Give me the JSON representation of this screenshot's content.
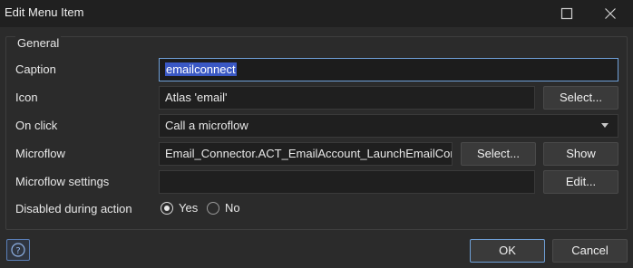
{
  "window": {
    "title": "Edit Menu Item"
  },
  "group": {
    "legend": "General"
  },
  "caption": {
    "label": "Caption",
    "value": "emailconnect"
  },
  "icon": {
    "label": "Icon",
    "value": "Atlas 'email'",
    "select_label": "Select..."
  },
  "on_click": {
    "label": "On click",
    "value": "Call a microflow"
  },
  "microflow": {
    "label": "Microflow",
    "value": "Email_Connector.ACT_EmailAccount_LaunchEmailConnector",
    "select_label": "Select...",
    "show_label": "Show"
  },
  "microflow_settings": {
    "label": "Microflow settings",
    "value": "",
    "edit_label": "Edit..."
  },
  "disabled_during_action": {
    "label": "Disabled during action",
    "options": [
      "Yes",
      "No"
    ],
    "selected": "Yes"
  },
  "footer": {
    "ok_label": "OK",
    "cancel_label": "Cancel",
    "help_icon": "question-icon"
  },
  "colors": {
    "accent": "#6fa0d8",
    "selection": "#3a58c4",
    "background": "#2b2b2b"
  }
}
